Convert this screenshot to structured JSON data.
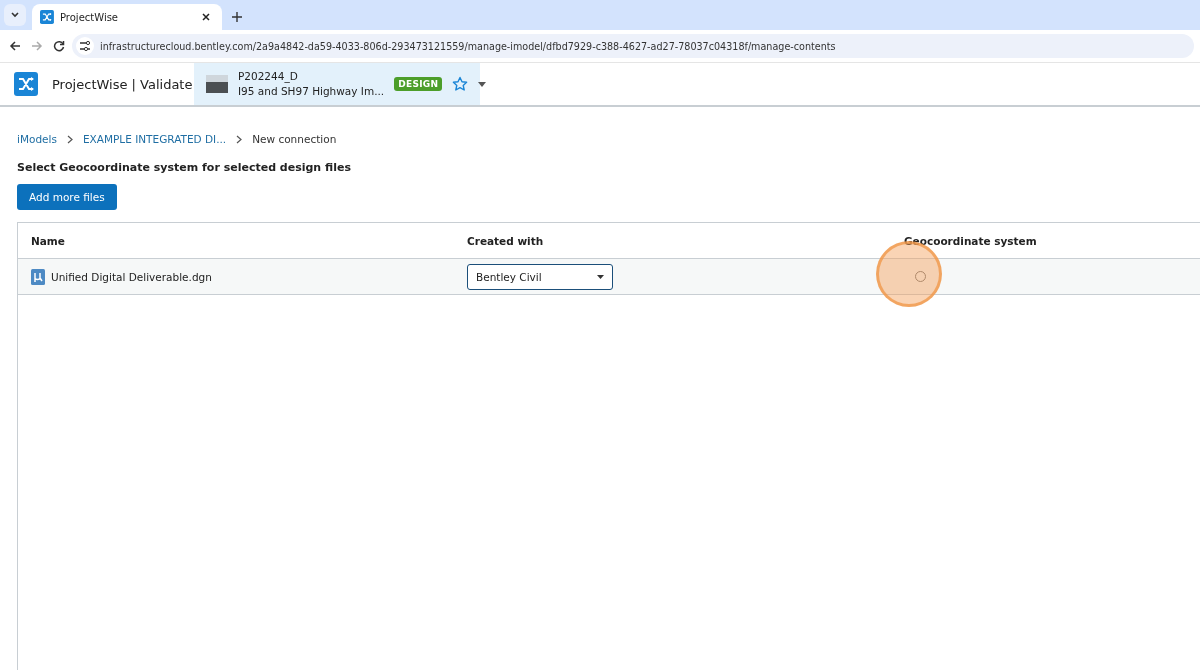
{
  "browser": {
    "tabs": [
      {
        "title": "ProjectWise",
        "selected": true
      }
    ],
    "url": "infrastructurecloud.bentley.com/2a9a4842-da59-4033-806d-293473121559/manage-imodel/dfbd7929-c388-4627-ad27-78037c04318f/manage-contents"
  },
  "app": {
    "product": "ProjectWise | Validate",
    "project": {
      "number": "P202244_D",
      "name": "I95 and SH97 Highway Im...",
      "badge": "DESIGN",
      "favorite": false
    }
  },
  "breadcrumbs": [
    {
      "label": "iModels",
      "kind": "link"
    },
    {
      "label": "EXAMPLE INTEGRATED DI...",
      "kind": "link"
    },
    {
      "label": "New connection",
      "kind": "current"
    }
  ],
  "heading": "Select Geocoordinate system for selected design files",
  "add_button": "Add more files",
  "table": {
    "columns": [
      "Name",
      "Created with",
      "Geocoordinate system"
    ],
    "rows": [
      {
        "name": "Unified Digital Deliverable.dgn",
        "created_with": "Bentley Civil",
        "geocoordinate": {
          "selected": false
        },
        "click_marker": true
      }
    ]
  }
}
